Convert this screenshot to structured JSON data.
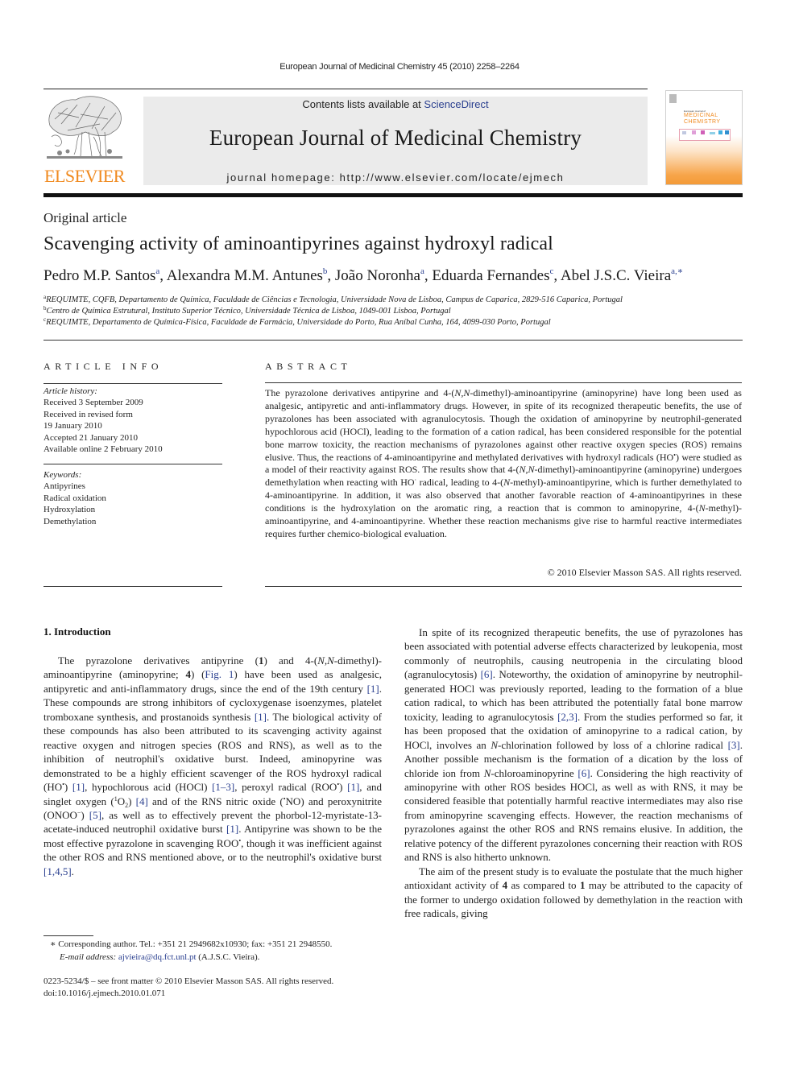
{
  "running_head": "European Journal of Medicinal Chemistry 45 (2010) 2258–2264",
  "masthead": {
    "publisher_logo_text": "ELSEVIER",
    "contents_prefix": "Contents lists available at ",
    "contents_link": "ScienceDirect",
    "journal_title": "European Journal of Medicinal Chemistry",
    "homepage_line": "journal homepage: http://www.elsevier.com/locate/ejmech",
    "cover": {
      "small_title": "European Journal of",
      "line1": "MEDICINAL",
      "line2": "CHEMISTRY"
    }
  },
  "article": {
    "type": "Original article",
    "title": "Scavenging activity of aminoantipyrines against hydroxyl radical",
    "authors": [
      {
        "name": "Pedro M.P. Santos",
        "sup": "a"
      },
      {
        "name": "Alexandra M.M. Antunes",
        "sup": "b"
      },
      {
        "name": "João Noronha",
        "sup": "a"
      },
      {
        "name": "Eduarda Fernandes",
        "sup": "c"
      },
      {
        "name": "Abel J.S.C. Vieira",
        "sup": "a,∗"
      }
    ],
    "affiliations": [
      {
        "sup": "a",
        "text": "REQUIMTE, CQFB, Departamento de Química, Faculdade de Ciências e Tecnologia, Universidade Nova de Lisboa, Campus de Caparica, 2829-516 Caparica, Portugal"
      },
      {
        "sup": "b",
        "text": "Centro de Química Estrutural, Instituto Superior Técnico, Universidade Técnica de Lisboa, 1049-001 Lisboa, Portugal"
      },
      {
        "sup": "c",
        "text": "REQUIMTE, Departamento de Química-Física, Faculdade de Farmácia, Universidade do Porto, Rua Aníbal Cunha, 164, 4099-030 Porto, Portugal"
      }
    ]
  },
  "article_info": {
    "heading": "ARTICLE INFO",
    "history_label": "Article history:",
    "history": [
      "Received 3 September 2009",
      "Received in revised form",
      "19 January 2010",
      "Accepted 21 January 2010",
      "Available online 2 February 2010"
    ],
    "keywords_label": "Keywords:",
    "keywords": [
      "Antipyrines",
      "Radical oxidation",
      "Hydroxylation",
      "Demethylation"
    ]
  },
  "abstract": {
    "heading": "ABSTRACT",
    "parts": [
      "The pyrazolone derivatives antipyrine and 4-(",
      "N,N",
      "-dimethyl)-aminoantipyrine (aminopyrine) have long been used as analgesic, antipyretic and anti-inflammatory drugs. However, in spite of its recognized therapeutic benefits, the use of pyrazolones has been associated with agranulocytosis. Though the oxidation of aminopyrine by neutrophil-generated hypochlorous acid (HOCl), leading to the formation of a cation radical, has been considered responsible for the potential bone marrow toxicity, the reaction mechanisms of pyrazolones against other reactive oxygen species (ROS) remains elusive. Thus, the reactions of 4-aminoantipyrine and methylated derivatives with hydroxyl radicals (HO",
      "•",
      ") were studied as a model of their reactivity against ROS. The results show that 4-(",
      "N,N",
      "-dimethyl)-aminoantipyrine (aminopyrine) undergoes demethylation when reacting with HO",
      "·",
      " radical, leading to 4-(",
      "N",
      "-methyl)-aminoantipyrine, which is further demethylated to 4-aminoantipyrine. In addition, it was also observed that another favorable reaction of 4-aminoantipyrines in these conditions is the hydroxylation on the aromatic ring, a reaction that is common to aminopyrine, 4-(",
      "N",
      "-methyl)-aminoantipyrine, and 4-aminoantipyrine. Whether these reaction mechanisms give rise to harmful reactive intermediates requires further chemico-biological evaluation."
    ],
    "copyright": "© 2010 Elsevier Masson SAS. All rights reserved."
  },
  "introduction": {
    "heading": "1.  Introduction",
    "left_paragraph": [
      {
        "t": "The pyrazolone derivatives antipyrine ("
      },
      {
        "t": "1",
        "b": true
      },
      {
        "t": ") and 4-("
      },
      {
        "t": "N,N",
        "i": true
      },
      {
        "t": "-dimethyl)-aminoantipyrine (aminopyrine; "
      },
      {
        "t": "4",
        "b": true
      },
      {
        "t": ") ("
      },
      {
        "t": "Fig. 1",
        "link": true
      },
      {
        "t": ") have been used as analgesic, antipyretic and anti-inflammatory drugs, since the end of the 19th century "
      },
      {
        "t": "[1]",
        "link": true
      },
      {
        "t": ". These compounds are strong inhibitors of cycloxygenase isoenzymes, platelet tromboxane synthesis, and prostanoids synthesis "
      },
      {
        "t": "[1]",
        "link": true
      },
      {
        "t": ". The biological activity of these compounds has also been attributed to its scavenging activity against reactive oxygen and nitrogen species (ROS and RNS), as well as to the inhibition of neutrophil's oxidative burst. Indeed, aminopyrine was demonstrated to be a highly efficient scavenger of the ROS hydroxyl radical (HO"
      },
      {
        "t": "•",
        "sup": true
      },
      {
        "t": ") "
      },
      {
        "t": "[1]",
        "link": true
      },
      {
        "t": ", hypochlorous acid (HOCl) "
      },
      {
        "t": "[1–3]",
        "link": true
      },
      {
        "t": ", peroxyl radical (ROO"
      },
      {
        "t": "•",
        "sup": true
      },
      {
        "t": ") "
      },
      {
        "t": "[1]",
        "link": true
      },
      {
        "t": ", and singlet oxygen ("
      },
      {
        "t": "1",
        "sup": true
      },
      {
        "t": "O"
      },
      {
        "t": "2",
        "sub": true
      },
      {
        "t": ") "
      },
      {
        "t": "[4]",
        "link": true
      },
      {
        "t": " and of the RNS nitric oxide ("
      },
      {
        "t": "•",
        "sup": true
      },
      {
        "t": "NO) and peroxynitrite (ONOO"
      },
      {
        "t": "−",
        "sup": true
      },
      {
        "t": ") "
      },
      {
        "t": "[5]",
        "link": true
      },
      {
        "t": ", as well as to effectively prevent the phorbol-12-myristate-13-acetate-induced neutrophil oxidative burst "
      },
      {
        "t": "[1]",
        "link": true
      },
      {
        "t": ". Antipyrine was shown to be the most effective pyrazolone in scavenging ROO"
      },
      {
        "t": "•",
        "sup": true
      },
      {
        "t": ", though it was inefficient against the other ROS and RNS mentioned above, or to the neutrophil's oxidative burst "
      },
      {
        "t": "[1,4,5]",
        "link": true
      },
      {
        "t": "."
      }
    ],
    "right_paragraph_1": [
      {
        "t": "In spite of its recognized therapeutic benefits, the use of pyrazolones has been associated with potential adverse effects characterized by leukopenia, most commonly of neutrophils, causing neutropenia in the circulating blood (agranulocytosis) "
      },
      {
        "t": "[6]",
        "link": true
      },
      {
        "t": ". Noteworthy, the oxidation of aminopyrine by neutrophil-generated HOCl was previously reported, leading to the formation of a blue cation radical, to which has been attributed the potentially fatal bone marrow toxicity, leading to agranulocytosis "
      },
      {
        "t": "[2,3]",
        "link": true
      },
      {
        "t": ". From the studies performed so far, it has been proposed that the oxidation of aminopyrine to a radical cation, by HOCl, involves an "
      },
      {
        "t": "N",
        "i": true
      },
      {
        "t": "-chlorination followed by loss of a chlorine radical "
      },
      {
        "t": "[3]",
        "link": true
      },
      {
        "t": ". Another possible mechanism is the formation of a dication by the loss of chloride ion from "
      },
      {
        "t": "N",
        "i": true
      },
      {
        "t": "-chloroaminopyrine "
      },
      {
        "t": "[6]",
        "link": true
      },
      {
        "t": ". Considering the high reactivity of aminopyrine with other ROS besides HOCl, as well as with RNS, it may be considered feasible that potentially harmful reactive intermediates may also rise from aminopyrine scavenging effects. However, the reaction mechanisms of pyrazolones against the other ROS and RNS remains elusive. In addition, the relative potency of the different pyrazolones concerning their reaction with ROS and RNS is also hitherto unknown."
      }
    ],
    "right_paragraph_2": [
      {
        "t": "The aim of the present study is to evaluate the postulate that the much higher antioxidant activity of "
      },
      {
        "t": "4",
        "b": true
      },
      {
        "t": " as compared to "
      },
      {
        "t": "1",
        "b": true
      },
      {
        "t": " may be attributed to the capacity of the former to undergo oxidation followed by demethylation in the reaction with free radicals, giving"
      }
    ]
  },
  "footnote": {
    "marker": "∗",
    "text": " Corresponding author. Tel.: +351 21 2949682x10930; fax: +351 21 2948550.",
    "email_label": "E-mail address:",
    "email": "ajvieira@dq.fct.unl.pt",
    "email_suffix": " (A.J.S.C. Vieira)."
  },
  "front_matter": {
    "line1": "0223-5234/$ – see front matter © 2010 Elsevier Masson SAS. All rights reserved.",
    "line2": "doi:10.1016/j.ejmech.2010.01.071"
  },
  "colors": {
    "link": "#2a3f8f",
    "elsevier_orange": "#f08a1f",
    "masthead_gray": "#ebebeb"
  }
}
